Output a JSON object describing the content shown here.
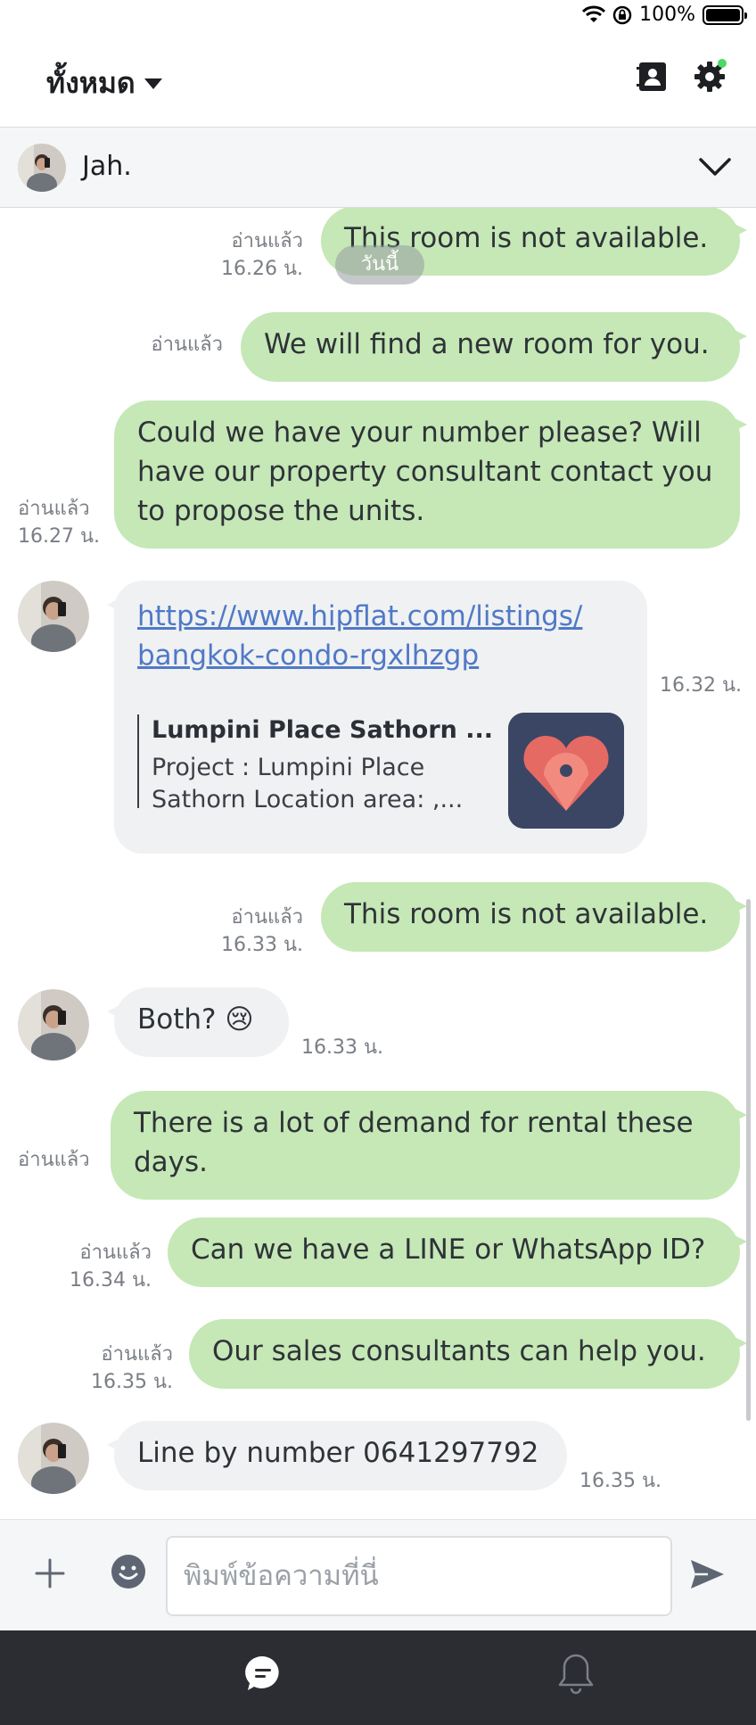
{
  "status": {
    "battery": "100%"
  },
  "header": {
    "filter_label": "ทั้งหมด"
  },
  "chat": {
    "contact_name": "Jah.",
    "date_pill": "วันนี้"
  },
  "messages": {
    "m1": {
      "text": "This room is not available.",
      "read": "อ่านแล้ว",
      "time": "16.26 น."
    },
    "m2": {
      "text": "We will find a new room for you.",
      "read": "อ่านแล้ว"
    },
    "m3": {
      "text": "Could we have your number please? Will have our property consultant contact you to propose the units.",
      "read": "อ่านแล้ว",
      "time": "16.27 น."
    },
    "m4": {
      "url": "https://www.hipflat.com/listings/bangkok-condo-rgxlhzgp",
      "url_line1": "https://www.hipflat.com/listings/",
      "url_line2": "bangkok-condo-rgxlhzgp",
      "preview_title": "Lumpini Place Sathorn ...",
      "preview_desc_line1": "Project : Lumpini Place",
      "preview_desc_line2": "Sathorn Location area: ,...",
      "time": "16.32 น."
    },
    "m5": {
      "text": "This room is not available.",
      "read": "อ่านแล้ว",
      "time": "16.33 น."
    },
    "m6": {
      "text": "Both? 😢",
      "time": "16.33 น."
    },
    "m7": {
      "text": "There is a lot of demand for rental these days.",
      "read": "อ่านแล้ว"
    },
    "m8": {
      "text": "Can we have a LINE or WhatsApp ID?",
      "read": "อ่านแล้ว",
      "time": "16.34 น."
    },
    "m9": {
      "text": "Our sales consultants can help you.",
      "read": "อ่านแล้ว",
      "time": "16.35 น."
    },
    "m10": {
      "text": "Line by number 0641297792",
      "time": "16.35 น."
    }
  },
  "input": {
    "placeholder": "พิมพ์ข้อความที่นี่",
    "value": ""
  },
  "icons": {
    "wifi": "wifi-icon",
    "rotation_lock": "rotation-lock-icon",
    "battery": "battery-icon",
    "contacts": "contact-book-icon",
    "settings": "gear-icon",
    "collapse": "chevron-down-icon",
    "add": "plus-icon",
    "emoji": "emoji-icon",
    "send": "send-icon",
    "nav_chat": "chat-bubble-icon",
    "nav_notifications": "bell-icon"
  },
  "colors": {
    "outgoing_bubble": "#c5e8b6",
    "incoming_bubble": "#f0f1f3",
    "link": "#5079c7",
    "settings_badge": "#4cd964",
    "bottom_nav": "#2b2d32"
  }
}
